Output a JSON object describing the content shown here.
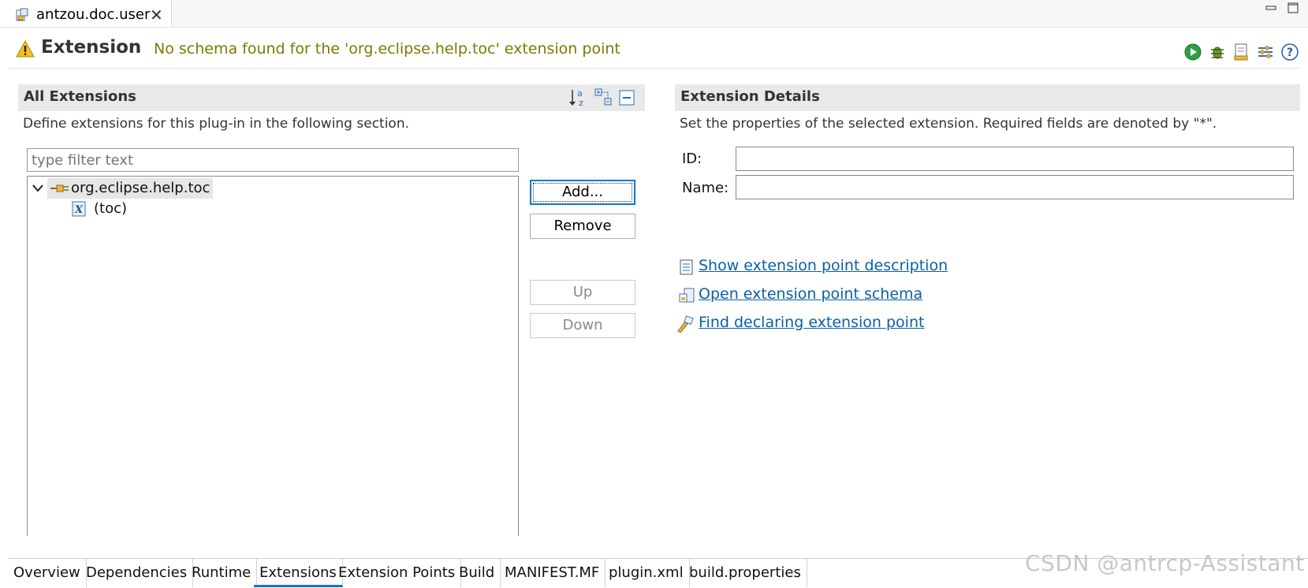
{
  "editor_tab": {
    "label": "antzou.doc.user",
    "close": "✕"
  },
  "header": {
    "title": "Extension",
    "message": "No schema found for the 'org.eclipse.help.toc' extension point"
  },
  "all_extensions": {
    "title": "All Extensions",
    "description": "Define extensions for this plug-in in the following section.",
    "filter_placeholder": "type filter text",
    "tree": [
      {
        "label": "org.eclipse.help.toc",
        "expanded": true,
        "icon": "extension-plug-icon"
      },
      {
        "label": "(toc)",
        "icon": "xml-element-icon"
      }
    ],
    "buttons": {
      "add": "Add...",
      "remove": "Remove",
      "up": "Up",
      "down": "Down"
    }
  },
  "details": {
    "title": "Extension Details",
    "description": "Set the properties of the selected extension. Required fields are denoted by \"*\".",
    "id_label": "ID:",
    "name_label": "Name:",
    "id_value": "",
    "name_value": "",
    "links": [
      "Show extension point description",
      "Open extension point schema",
      "Find declaring extension point"
    ]
  },
  "bottom_tabs": [
    "Overview",
    "Dependencies",
    "Runtime",
    "Extensions",
    "Extension Points",
    "Build",
    "MANIFEST.MF",
    "plugin.xml",
    "build.properties"
  ],
  "active_bottom_tab": "Extensions",
  "watermark": "CSDN @antrcp-Assistant",
  "colors": {
    "link": "#0a5fa8",
    "warning_text": "#7b7b00",
    "active_tab": "#1a6fd4"
  }
}
